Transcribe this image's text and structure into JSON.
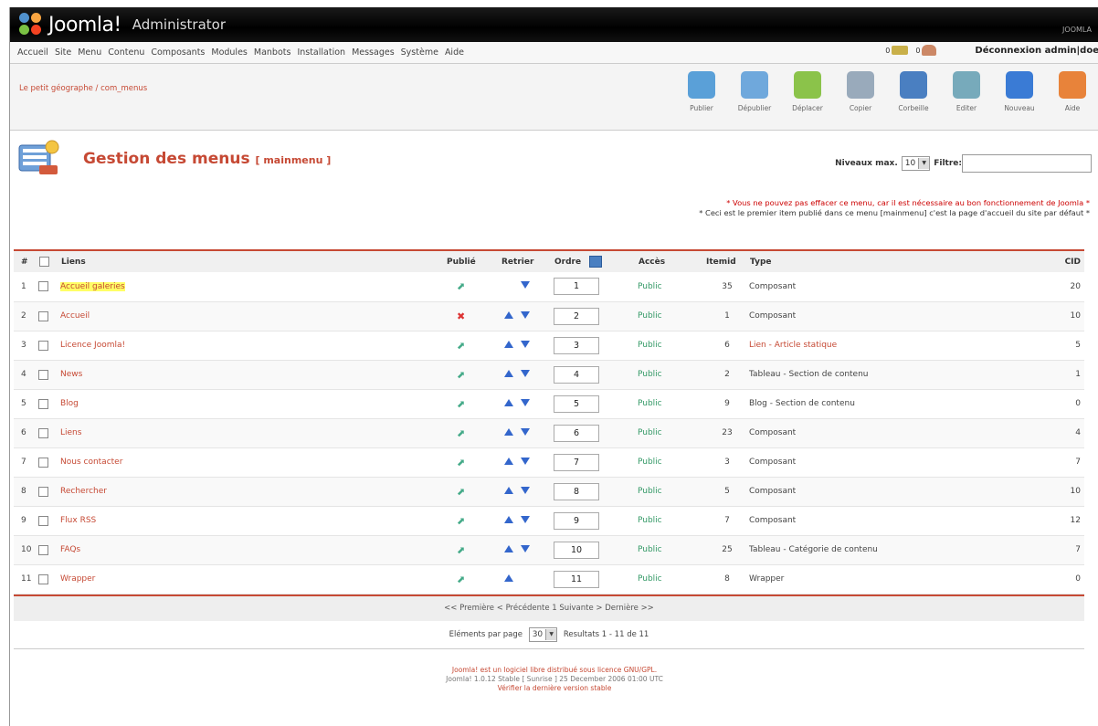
{
  "header": {
    "logo_text": "Joomla!",
    "subtitle": "Administrator",
    "version": "JOOMLA"
  },
  "menubar": {
    "items": [
      "Accueil",
      "Site",
      "Menu",
      "Contenu",
      "Composants",
      "Modules",
      "Manbots",
      "Installation",
      "Messages",
      "Système",
      "Aide"
    ],
    "count1": "0",
    "count2": "0",
    "logout": "Déconnexion admin|doe"
  },
  "toolbar": {
    "site_name": "Le petit géographe / com_menus",
    "buttons": [
      {
        "label": "Publier",
        "icon": "publish-icon",
        "color": "#5aa0d8"
      },
      {
        "label": "Dépublier",
        "icon": "unpublish-icon",
        "color": "#6fa8dc"
      },
      {
        "label": "Déplacer",
        "icon": "move-icon",
        "color": "#8bc34a"
      },
      {
        "label": "Copier",
        "icon": "copy-icon",
        "color": "#9ab"
      },
      {
        "label": "Corbeille",
        "icon": "trash-icon",
        "color": "#4a7fc1"
      },
      {
        "label": "Editer",
        "icon": "edit-icon",
        "color": "#7ab"
      },
      {
        "label": "Nouveau",
        "icon": "new-icon",
        "color": "#3a7bd5"
      },
      {
        "label": "Aide",
        "icon": "help-icon",
        "color": "#e8833a"
      }
    ]
  },
  "page": {
    "title": "Gestion des menus",
    "menu_tag": "[ mainmenu ]",
    "levels_label": "Niveaux max.",
    "levels_value": "10",
    "filter_label": "Filtre:",
    "filter_value": "",
    "note1": "* Vous ne pouvez pas effacer ce menu, car il est nécessaire au bon fonctionnement de Joomla *",
    "note2": "* Ceci est le premier item publié dans ce menu [mainmenu] c'est la page d'accueil du site par défaut *"
  },
  "table": {
    "headers": {
      "num": "#",
      "links": "Liens",
      "published": "Publié",
      "reorder": "Retrier",
      "order": "Ordre",
      "access": "Accès",
      "itemid": "Itemid",
      "type": "Type",
      "cid": "CID"
    },
    "rows": [
      {
        "num": "1",
        "name": "Accueil galeries",
        "published": true,
        "up": false,
        "down": true,
        "order": "1",
        "access": "Public",
        "itemid": "35",
        "type": "Composant",
        "cid": "20",
        "highlight": true,
        "type_link": false
      },
      {
        "num": "2",
        "name": "Accueil",
        "published": false,
        "up": true,
        "down": true,
        "order": "2",
        "access": "Public",
        "itemid": "1",
        "type": "Composant",
        "cid": "10",
        "highlight": false,
        "type_link": false
      },
      {
        "num": "3",
        "name": "Licence Joomla!",
        "published": true,
        "up": true,
        "down": true,
        "order": "3",
        "access": "Public",
        "itemid": "6",
        "type": "Lien - Article statique",
        "cid": "5",
        "highlight": false,
        "type_link": true
      },
      {
        "num": "4",
        "name": "News",
        "published": true,
        "up": true,
        "down": true,
        "order": "4",
        "access": "Public",
        "itemid": "2",
        "type": "Tableau - Section de contenu",
        "cid": "1",
        "highlight": false,
        "type_link": false
      },
      {
        "num": "5",
        "name": "Blog",
        "published": true,
        "up": true,
        "down": true,
        "order": "5",
        "access": "Public",
        "itemid": "9",
        "type": "Blog - Section de contenu",
        "cid": "0",
        "highlight": false,
        "type_link": false
      },
      {
        "num": "6",
        "name": "Liens",
        "published": true,
        "up": true,
        "down": true,
        "order": "6",
        "access": "Public",
        "itemid": "23",
        "type": "Composant",
        "cid": "4",
        "highlight": false,
        "type_link": false
      },
      {
        "num": "7",
        "name": "Nous contacter",
        "published": true,
        "up": true,
        "down": true,
        "order": "7",
        "access": "Public",
        "itemid": "3",
        "type": "Composant",
        "cid": "7",
        "highlight": false,
        "type_link": false
      },
      {
        "num": "8",
        "name": "Rechercher",
        "published": true,
        "up": true,
        "down": true,
        "order": "8",
        "access": "Public",
        "itemid": "5",
        "type": "Composant",
        "cid": "10",
        "highlight": false,
        "type_link": false
      },
      {
        "num": "9",
        "name": "Flux RSS",
        "published": true,
        "up": true,
        "down": true,
        "order": "9",
        "access": "Public",
        "itemid": "7",
        "type": "Composant",
        "cid": "12",
        "highlight": false,
        "type_link": false
      },
      {
        "num": "10",
        "name": "FAQs",
        "published": true,
        "up": true,
        "down": true,
        "order": "10",
        "access": "Public",
        "itemid": "25",
        "type": "Tableau - Catégorie de contenu",
        "cid": "7",
        "highlight": false,
        "type_link": false
      },
      {
        "num": "11",
        "name": "Wrapper",
        "published": true,
        "up": true,
        "down": false,
        "order": "11",
        "access": "Public",
        "itemid": "8",
        "type": "Wrapper",
        "cid": "0",
        "highlight": false,
        "type_link": false
      }
    ]
  },
  "pagination": {
    "nav": "<< Première < Précédente 1 Suivante > Dernière >>",
    "per_page_label": "Eléments par page",
    "per_page_value": "30",
    "results": "Resultats 1 - 11 de 11"
  },
  "footer": {
    "line1": "Joomla! est un logiciel libre distribué sous licence GNU/GPL.",
    "line2": "Joomla! 1.0.12 Stable [ Sunrise ] 25 December 2006 01:00 UTC",
    "line3": "Vérifier la dernière version stable"
  }
}
